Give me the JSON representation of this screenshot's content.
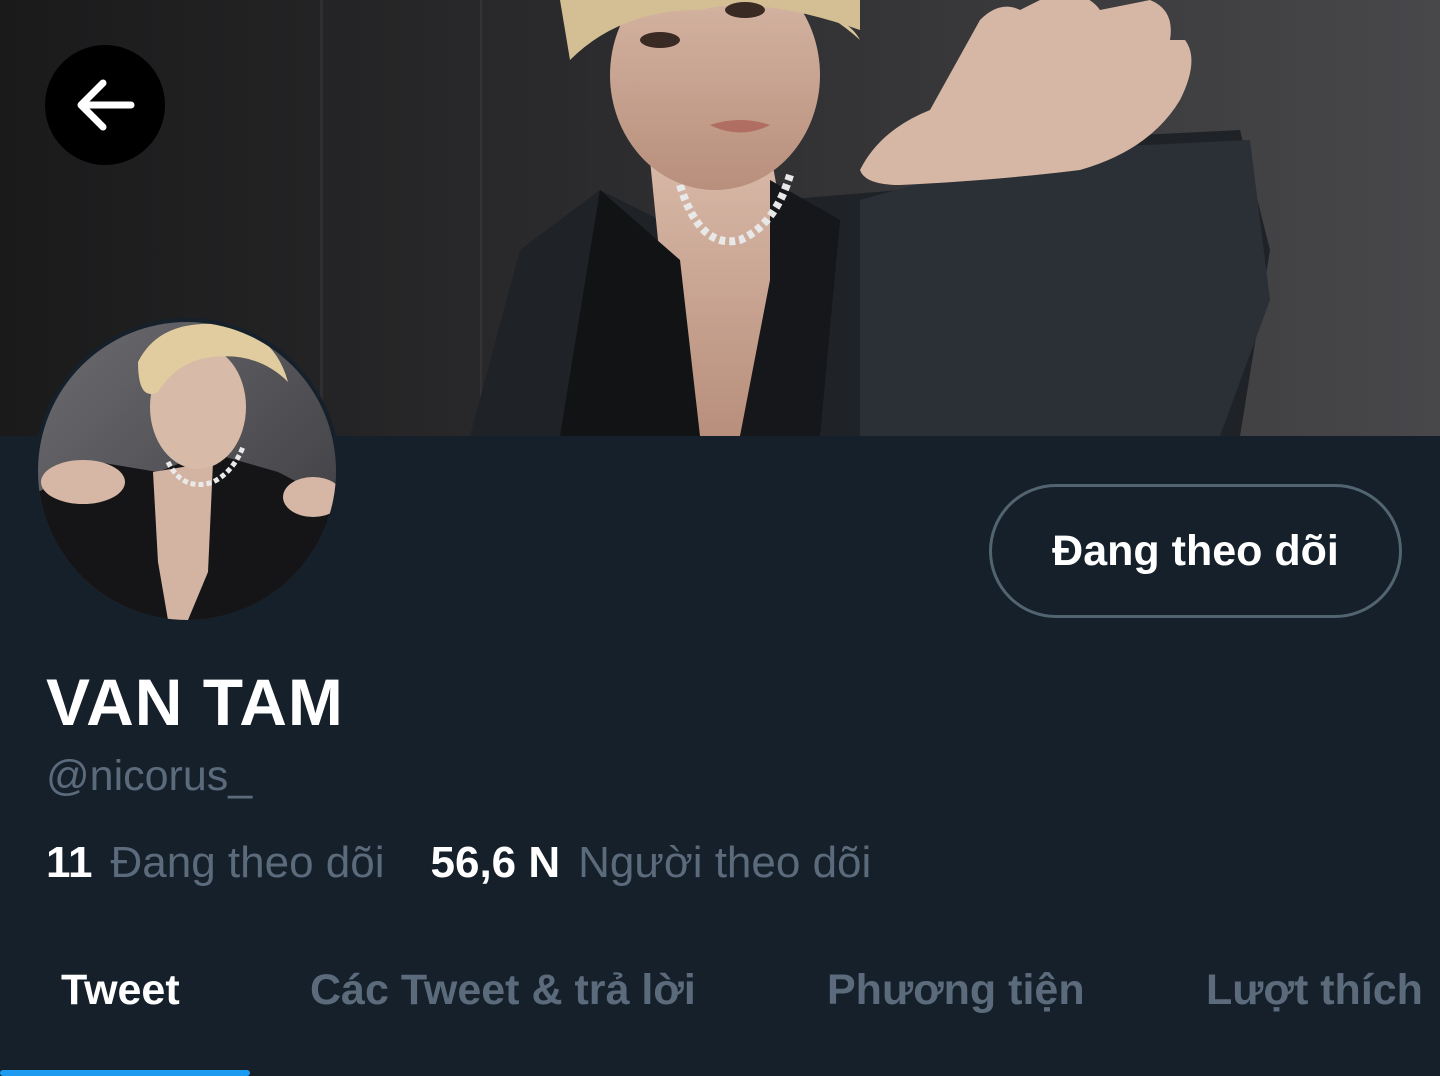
{
  "header": {
    "back_icon": "arrow-left-icon"
  },
  "profile": {
    "display_name": "VAN TAM",
    "handle": "@nicorus_",
    "follow_button_label": "Đang theo dõi"
  },
  "stats": {
    "following_count": "11",
    "following_label": "Đang theo dõi",
    "followers_count": "56,6 N",
    "followers_label": "Người theo dõi"
  },
  "tabs": [
    {
      "label": "Tweet",
      "active": true
    },
    {
      "label": "Các Tweet & trả lời",
      "active": false
    },
    {
      "label": "Phương tiện",
      "active": false
    },
    {
      "label": "Lượt thích",
      "active": false
    }
  ],
  "colors": {
    "background": "#15202b",
    "accent": "#1d9bf0",
    "secondary_text": "#5b6b7b",
    "primary_text": "#ffffff"
  }
}
